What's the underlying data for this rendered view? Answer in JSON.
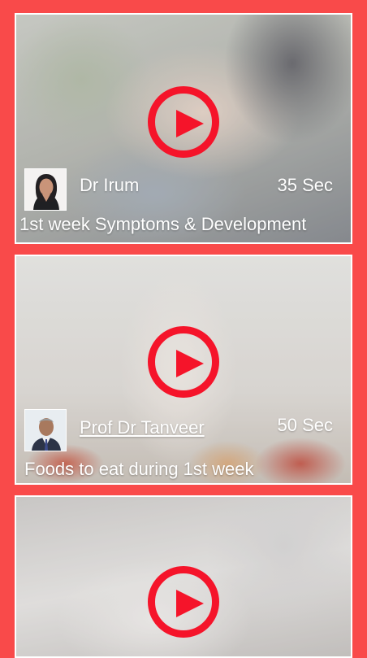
{
  "videos": [
    {
      "author": "Dr Irum",
      "duration": "35 Sec",
      "title": "1st week Symptoms & Development"
    },
    {
      "author": "Prof Dr Tanveer",
      "duration": "50 Sec",
      "title": "Foods to eat during 1st week"
    },
    {
      "author": "",
      "duration": "",
      "title": ""
    }
  ],
  "colors": {
    "background": "#f94a4a",
    "play": "#f5142a",
    "border": "#ffffff"
  },
  "icons": {
    "play": "play-circle-icon"
  }
}
